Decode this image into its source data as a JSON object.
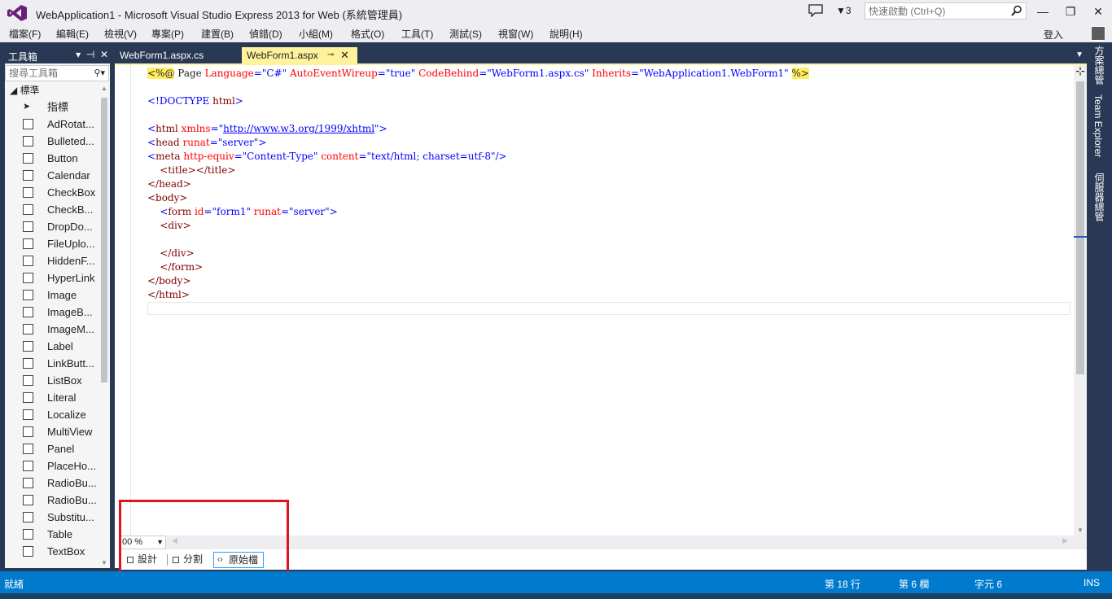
{
  "window": {
    "title": "WebApplication1 - Microsoft Visual Studio Express 2013 for Web (系統管理員)",
    "filter_count": "3",
    "quick_launch_placeholder": "快速啟動 (Ctrl+Q)",
    "minimize": "—",
    "restore": "❐",
    "close": "✕"
  },
  "menu": {
    "items": [
      "檔案(F)",
      "編輯(E)",
      "檢視(V)",
      "專案(P)",
      "建置(B)",
      "偵錯(D)",
      "小組(M)",
      "格式(O)",
      "工具(T)",
      "測試(S)",
      "視窗(W)",
      "說明(H)"
    ],
    "signin": "登入"
  },
  "toolbox": {
    "title": "工具箱",
    "search_placeholder": "搜尋工具箱",
    "group": "標準",
    "items": [
      "指標",
      "AdRotat...",
      "Bulleted...",
      "Button",
      "Calendar",
      "CheckBox",
      "CheckB...",
      "DropDo...",
      "FileUplo...",
      "HiddenF...",
      "HyperLink",
      "Image",
      "ImageB...",
      "ImageM...",
      "Label",
      "LinkButt...",
      "ListBox",
      "Literal",
      "Localize",
      "MultiView",
      "Panel",
      "PlaceHo...",
      "RadioBu...",
      "RadioBu...",
      "Substitu...",
      "Table",
      "TextBox"
    ]
  },
  "tabs": {
    "tab1": "WebForm1.aspx.cs",
    "tab2": "WebForm1.aspx"
  },
  "code": {
    "l1_a": "<%@",
    "l1_b": " Page ",
    "l1_c": "Language",
    "l1_d": "=",
    "l1_e": "\"C#\"",
    "l1_f": " AutoEventWireup",
    "l1_g": "\"true\"",
    "l1_h": " CodeBehind",
    "l1_i": "\"WebForm1.aspx.cs\"",
    "l1_j": " Inherits",
    "l1_k": "\"WebApplication1.WebForm1\"",
    "l1_l": "%>",
    "l3_a": "<!DOCTYPE ",
    "l3_b": "html",
    "l3_c": ">",
    "l5_a": "<html ",
    "l5_b": "xmlns",
    "l5_c": "=\"",
    "l5_d": "http://www.w3.org/1999/xhtml",
    "l5_e": "\">",
    "l6_a": "<head ",
    "l6_b": "runat",
    "l6_c": "=\"server\"",
    "l6_d": ">",
    "l7_a": "<meta ",
    "l7_b": "http-equiv",
    "l7_c": "=\"Content-Type\"",
    "l7_d": " content",
    "l7_e": "=\"text/html; charset=utf-8\"",
    "l7_f": "/>",
    "l8": "    <title></title>",
    "l9": "</head>",
    "l10": "<body>",
    "l11_a": "    <form ",
    "l11_b": "id",
    "l11_c": "=\"form1\"",
    "l11_d": " runat",
    "l11_e": "=\"server\"",
    "l11_f": ">",
    "l12": "    <div>",
    "l14": "    </div>",
    "l15": "    </form>",
    "l16": "</body>",
    "l17": "</html>"
  },
  "zoom": "00 %",
  "views": {
    "design": "設計",
    "split": "分割",
    "source": "原始檔"
  },
  "rightdock": {
    "solution": "方案總管",
    "team": "Team Explorer",
    "server": "伺服器總管"
  },
  "status": {
    "ready": "就緒",
    "line": "第 18 行",
    "col": "第 6 欄",
    "ch": "字元 6",
    "ins": "INS"
  }
}
